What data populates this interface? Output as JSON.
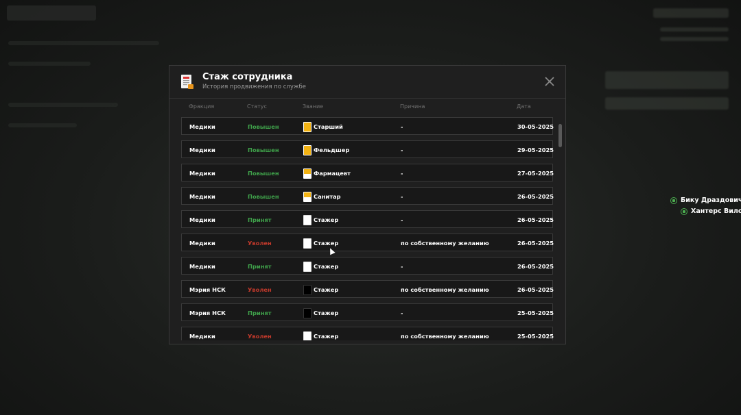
{
  "modal": {
    "title": "Стаж сотрудника",
    "subtitle": "История продвижения по службе",
    "columns": {
      "faction": "Фракция",
      "status": "Статус",
      "rank": "Звание",
      "reason": "Причина",
      "date": "Дата"
    },
    "rows": [
      {
        "faction": "Медики",
        "status": "Повышен",
        "status_kind": "promoted",
        "rank": "Старший",
        "rank_icon": "rank-badge-yellow",
        "reason": "-",
        "date": "30-05-2025"
      },
      {
        "faction": "Медики",
        "status": "Повышен",
        "status_kind": "promoted",
        "rank": "Фельдшер",
        "rank_icon": "rank-badge-yellow",
        "reason": "-",
        "date": "29-05-2025"
      },
      {
        "faction": "Медики",
        "status": "Повышен",
        "status_kind": "promoted",
        "rank": "Фармацевт",
        "rank_icon": "rank-badge-yellow-white",
        "reason": "-",
        "date": "27-05-2025"
      },
      {
        "faction": "Медики",
        "status": "Повышен",
        "status_kind": "promoted",
        "rank": "Санитар",
        "rank_icon": "rank-badge-yellow-white",
        "reason": "-",
        "date": "26-05-2025"
      },
      {
        "faction": "Медики",
        "status": "Принят",
        "status_kind": "accepted",
        "rank": "Стажер",
        "rank_icon": "rank-badge-white",
        "reason": "-",
        "date": "26-05-2025"
      },
      {
        "faction": "Медики",
        "status": "Уволен",
        "status_kind": "fired",
        "rank": "Стажер",
        "rank_icon": "rank-badge-white",
        "reason": "по собственному желанию",
        "date": "26-05-2025"
      },
      {
        "faction": "Медики",
        "status": "Принят",
        "status_kind": "accepted",
        "rank": "Стажер",
        "rank_icon": "rank-badge-white",
        "reason": "-",
        "date": "26-05-2025"
      },
      {
        "faction": "Мэрия НСК",
        "status": "Уволен",
        "status_kind": "fired",
        "rank": "Стажер",
        "rank_icon": "rank-badge-black",
        "reason": "по собственному желанию",
        "date": "26-05-2025"
      },
      {
        "faction": "Мэрия НСК",
        "status": "Принят",
        "status_kind": "accepted",
        "rank": "Стажер",
        "rank_icon": "rank-badge-black",
        "reason": "-",
        "date": "25-05-2025"
      },
      {
        "faction": "Медики",
        "status": "Уволен",
        "status_kind": "fired",
        "rank": "Стажер",
        "rank_icon": "rank-badge-white",
        "reason": "по собственному желанию",
        "date": "25-05-2025"
      }
    ]
  },
  "players": [
    {
      "name": "Бику Драздович"
    },
    {
      "name": "Хантерс Вилс"
    }
  ],
  "colors": {
    "promoted": "#3fa14a",
    "accepted": "#3fa14a",
    "fired": "#c0392b"
  }
}
